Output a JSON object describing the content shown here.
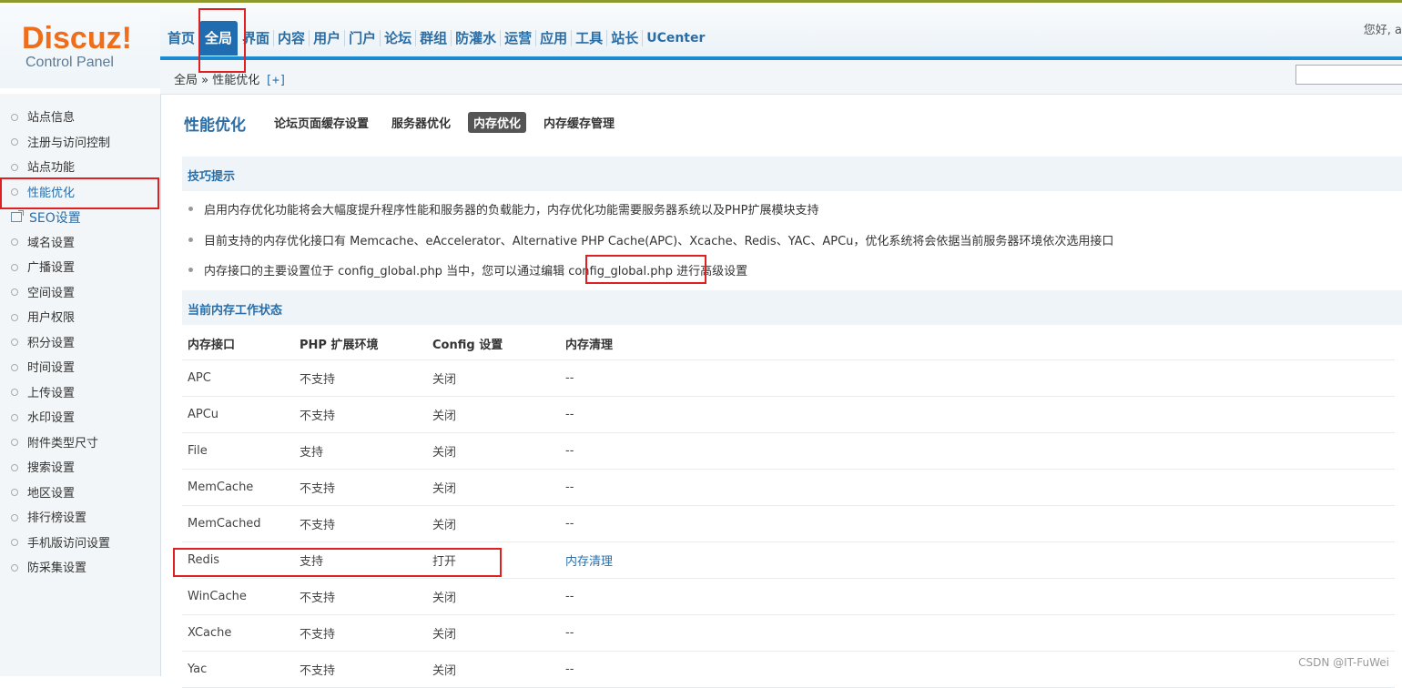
{
  "logo": {
    "word": "Discuz!",
    "subtitle": "Control Panel"
  },
  "header": {
    "nav": [
      "首页",
      "全局",
      "界面",
      "内容",
      "用户",
      "门户",
      "论坛",
      "群组",
      "防灌水",
      "运营",
      "应用",
      "工具",
      "站长",
      "UCenter"
    ],
    "active_nav": "全局",
    "greeting": "您好, a"
  },
  "breadcrumb": {
    "text": "全局 » 性能优化",
    "plus": "[+]"
  },
  "sidebar": {
    "items": [
      "站点信息",
      "注册与访问控制",
      "站点功能",
      "性能优化",
      "SEO设置",
      "域名设置",
      "广播设置",
      "空间设置",
      "用户权限",
      "积分设置",
      "时间设置",
      "上传设置",
      "水印设置",
      "附件类型尺寸",
      "搜索设置",
      "地区设置",
      "排行榜设置",
      "手机版访问设置",
      "防采集设置"
    ],
    "active": "性能优化"
  },
  "main": {
    "title": "性能优化",
    "subtabs": [
      "论坛页面缓存设置",
      "服务器优化",
      "内存优化",
      "内存缓存管理"
    ],
    "active_subtab": "内存优化",
    "tips_title": "技巧提示",
    "tips": [
      "启用内存优化功能将会大幅度提升程序性能和服务器的负载能力，内存优化功能需要服务器系统以及PHP扩展模块支持",
      "目前支持的内存优化接口有 Memcache、eAccelerator、Alternative PHP Cache(APC)、Xcache、Redis、YAC、APCu，优化系统将会依据当前服务器环境依次选用接口",
      "内存接口的主要设置位于 config_global.php 当中，您可以通过编辑 config_global.php 进行高级设置"
    ],
    "status_title": "当前内存工作状态",
    "table": {
      "headers": [
        "内存接口",
        "PHP 扩展环境",
        "Config 设置",
        "内存清理"
      ],
      "rows": [
        [
          "APC",
          "不支持",
          "关闭",
          "--"
        ],
        [
          "APCu",
          "不支持",
          "关闭",
          "--"
        ],
        [
          "File",
          "支持",
          "关闭",
          "--"
        ],
        [
          "MemCache",
          "不支持",
          "关闭",
          "--"
        ],
        [
          "MemCached",
          "不支持",
          "关闭",
          "--"
        ],
        [
          "Redis",
          "支持",
          "打开",
          "内存清理"
        ],
        [
          "WinCache",
          "不支持",
          "关闭",
          "--"
        ],
        [
          "XCache",
          "不支持",
          "关闭",
          "--"
        ],
        [
          "Yac",
          "不支持",
          "关闭",
          "--"
        ]
      ]
    }
  },
  "watermark": "CSDN @IT-FuWei",
  "colors": {
    "highlight": "#e02020",
    "accent": "#2b6ea6",
    "logo": "#ee6e1b"
  }
}
